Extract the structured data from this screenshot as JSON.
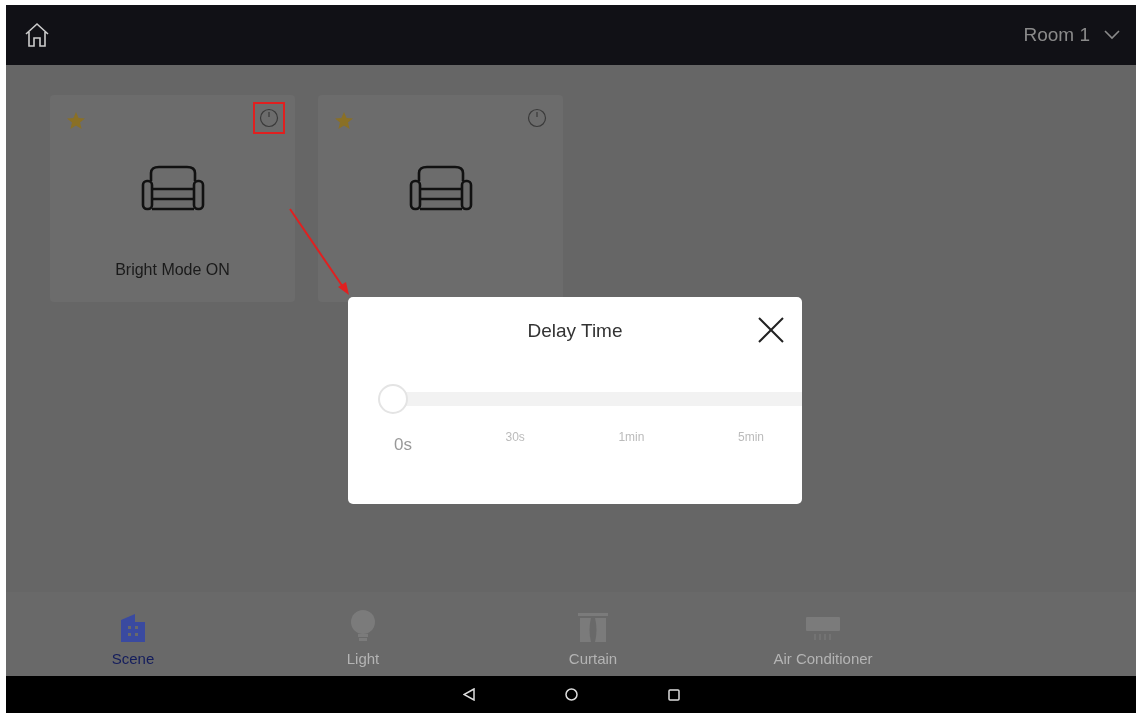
{
  "header": {
    "room": "Room 1"
  },
  "scenes": [
    {
      "name": "Bright Mode ON",
      "favorite": true,
      "highlighted": true
    },
    {
      "favorite": true,
      "highlighted": false
    }
  ],
  "dialog": {
    "title": "Delay Time",
    "slider": {
      "level": 0
    },
    "ticks": [
      {
        "label": "0s",
        "selected": true
      },
      {
        "label": "30s",
        "selected": false
      },
      {
        "label": "1min",
        "selected": false
      },
      {
        "label": "5min",
        "selected": false
      }
    ]
  },
  "tabs": [
    {
      "kind": "scene",
      "label": "Scene",
      "selected": true
    },
    {
      "kind": "light",
      "label": "Light",
      "selected": false
    },
    {
      "kind": "curtain",
      "label": "Curtain",
      "selected": false
    },
    {
      "kind": "ac",
      "label": "Air Conditioner",
      "selected": false
    }
  ]
}
